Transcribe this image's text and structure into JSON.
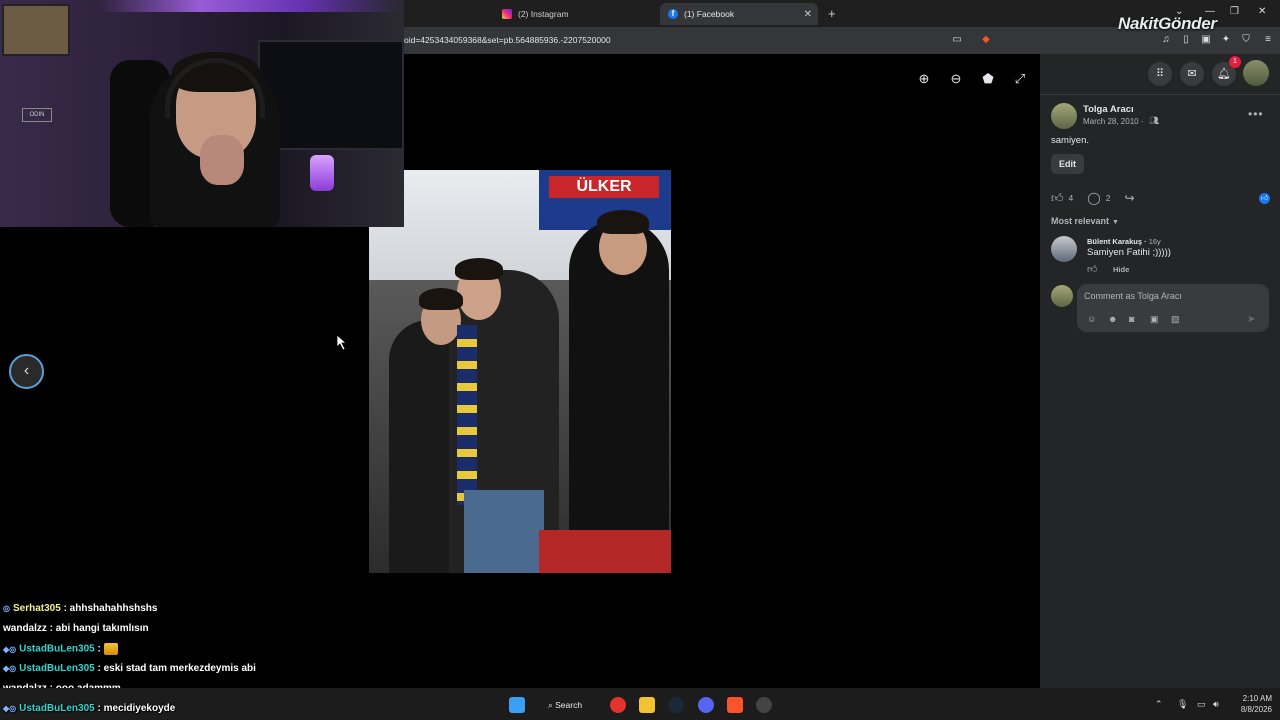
{
  "browser": {
    "tabs": [
      {
        "label": "(2) Instagram",
        "icon": "instagram-icon"
      },
      {
        "label": "(1) Facebook",
        "icon": "facebook-icon",
        "active": true
      }
    ],
    "url": "oid=4253434059368&set=pb.564885936.-2207520000"
  },
  "watermark": "NakitGönder",
  "viewer": {
    "tools": [
      "zoom-in-icon",
      "zoom-out-icon",
      "tag-icon",
      "fullscreen-icon"
    ],
    "prev_icon": "chevron-left-icon"
  },
  "photo": {
    "banner_text": "ÜLKER"
  },
  "cam": {
    "sign_text": "ODIN"
  },
  "topbar": {
    "notification_count": "1"
  },
  "post": {
    "author": "Tolga Aracı",
    "date": "March 28, 2010 ·",
    "caption": "samiyen.",
    "edit_label": "Edit",
    "likes": "4",
    "comments": "2",
    "sort_label": "Most relevant"
  },
  "comment": {
    "author": "Bülent Karakuş ·",
    "age": "16y",
    "text": "Samiyen Fatihi ;)))))",
    "hide_label": "Hide"
  },
  "compose": {
    "placeholder": "Comment as Tolga Aracı"
  },
  "chat": [
    {
      "user": "Serhat305",
      "message": " : ahhshahahhshshs",
      "color": "yellow",
      "badges": "◎"
    },
    {
      "user": "wandalzz",
      "message": " : abi hangi takımlısın",
      "color": "plain",
      "badges": ""
    },
    {
      "user": "UstadBuLen305",
      "message": " : ",
      "color": "cyan",
      "badges": "◆◎",
      "emote": true
    },
    {
      "user": "UstadBuLen305",
      "message": " : eski stad tam merkezdeymis abi",
      "color": "cyan",
      "badges": "◆◎"
    },
    {
      "user": "wandalzz",
      "message": " : ooo adammm",
      "color": "plain",
      "badges": ""
    },
    {
      "user": "UstadBuLen305",
      "message": " : mecidiyekoyde",
      "color": "cyan",
      "badges": "◆◎"
    }
  ],
  "taskbar": {
    "search_label": "Search",
    "time": "2:10 AM",
    "date": "8/8/2026"
  }
}
